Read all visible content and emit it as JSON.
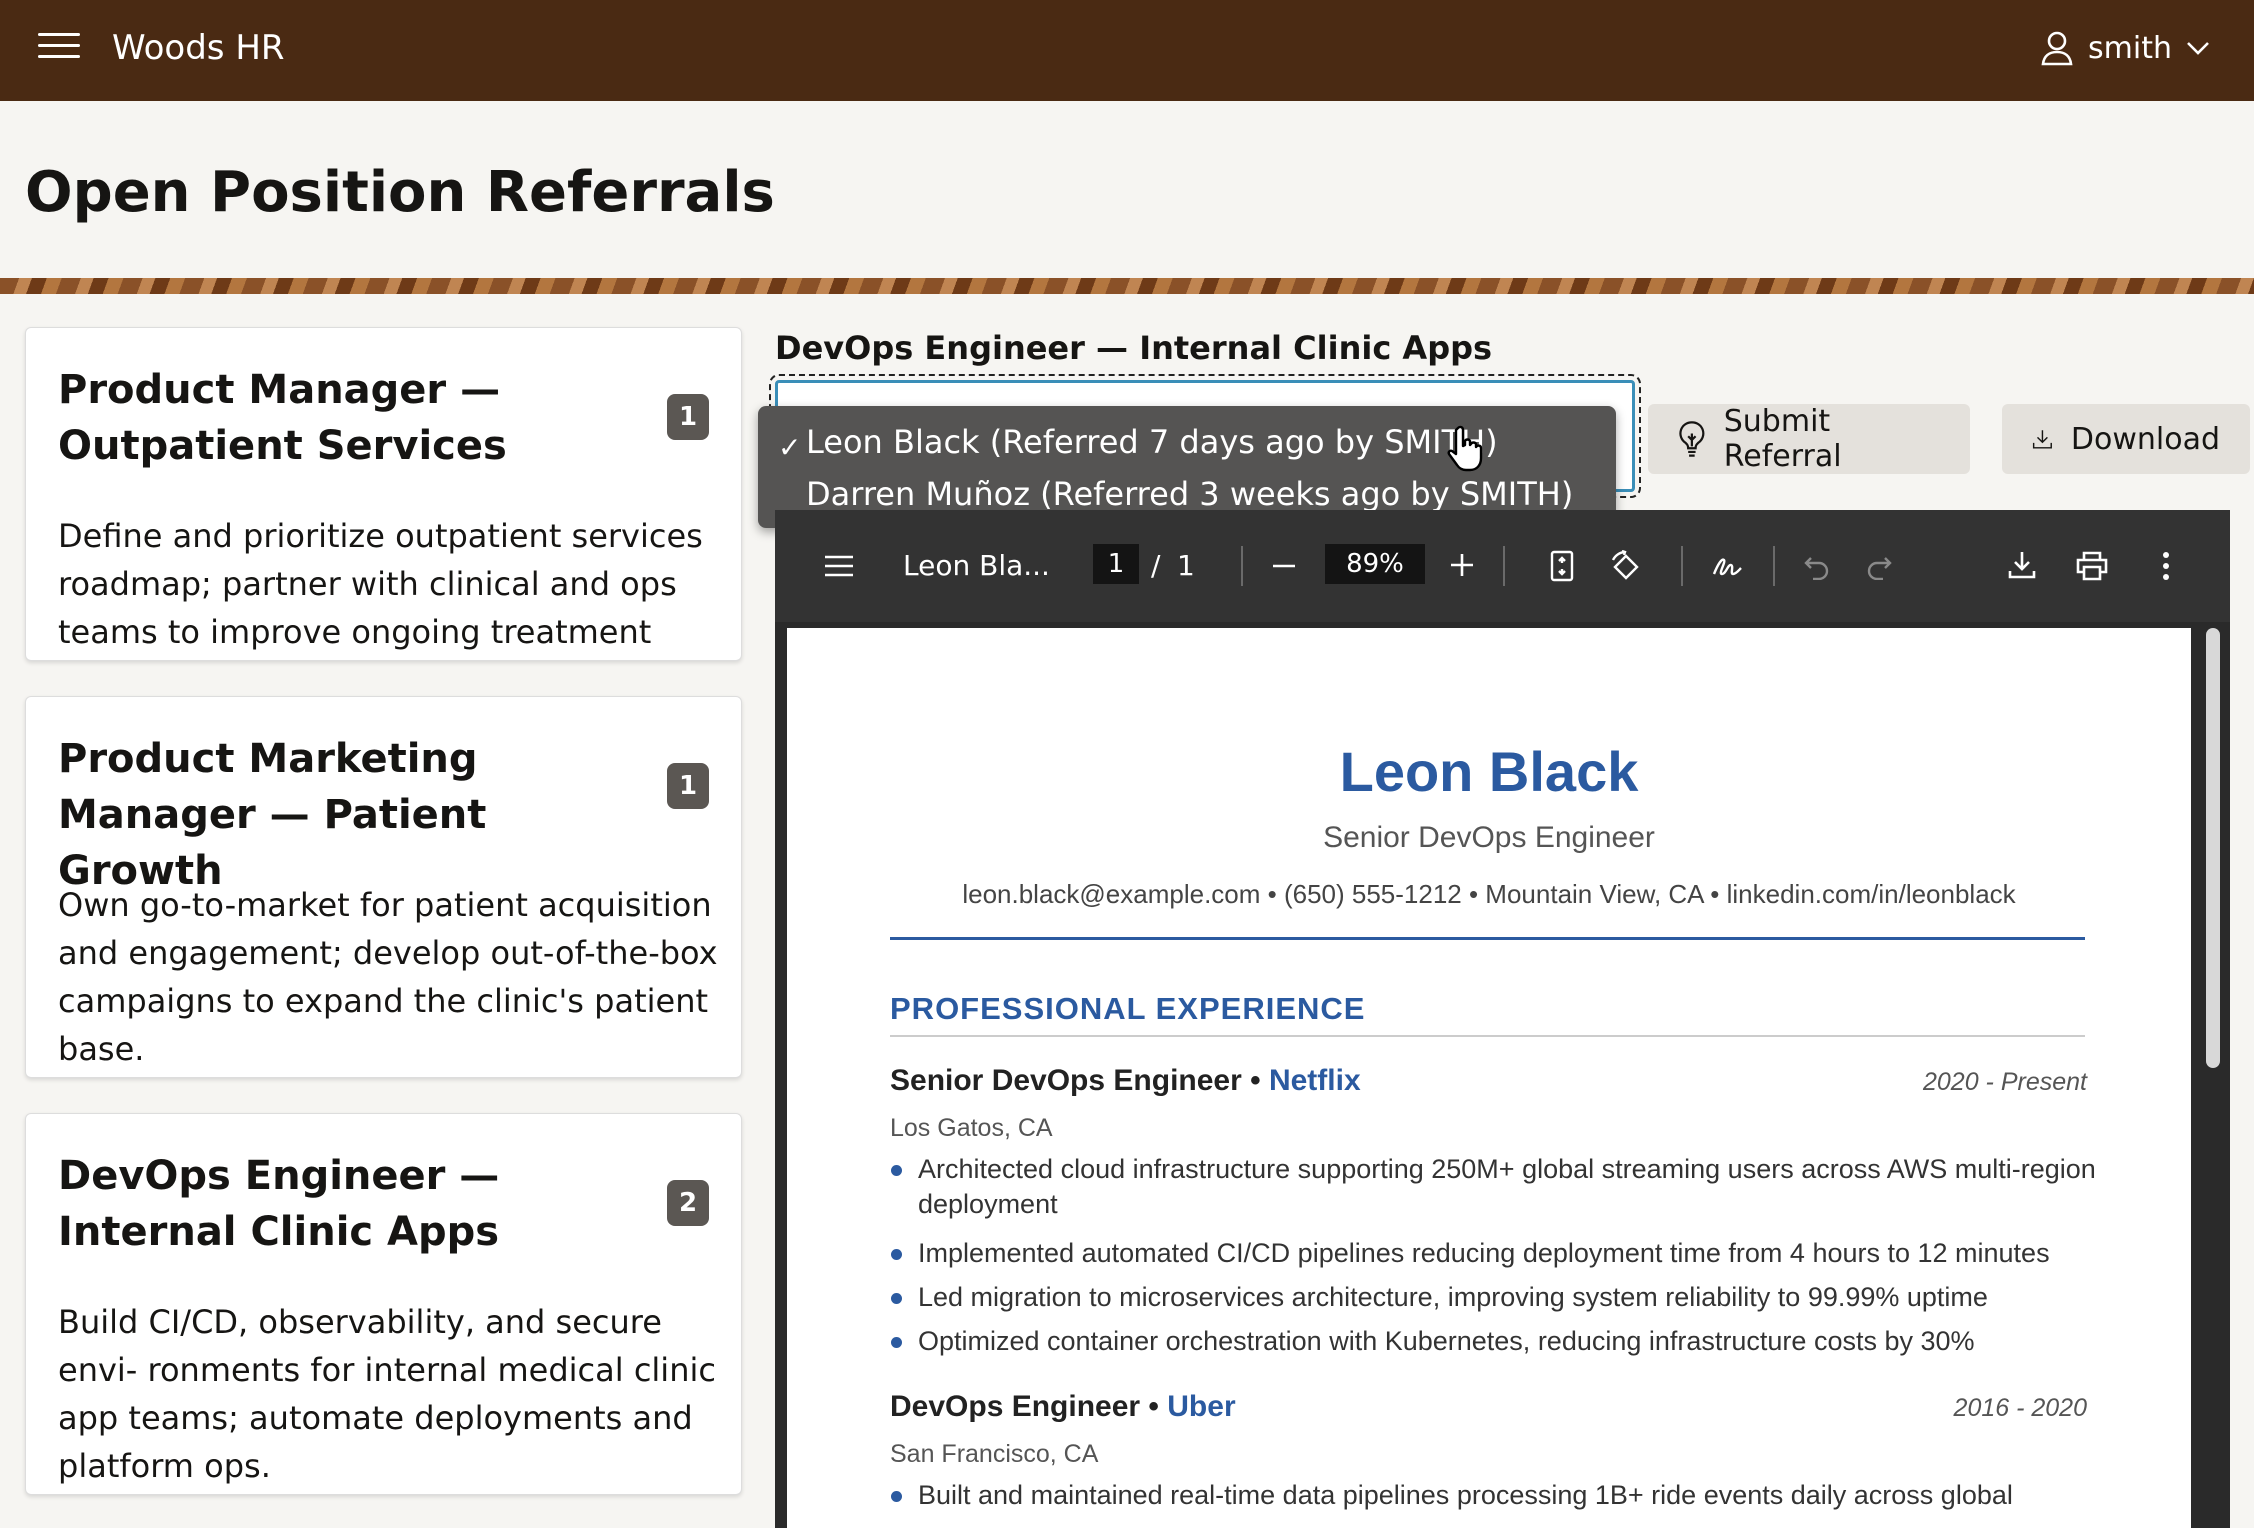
{
  "header": {
    "app_title": "Woods HR",
    "username": "smith"
  },
  "page": {
    "title": "Open Position Referrals"
  },
  "positions": [
    {
      "title": "Product Manager — Outpatient Services",
      "count": "1",
      "description": "Define and prioritize outpatient services roadmap; partner with clinical and ops teams to improve ongoing treatment experiences."
    },
    {
      "title": "Product Marketing Manager — Patient Growth",
      "count": "1",
      "description": "Own go-to-market for patient acquisition and engagement; develop out-of-the-box campaigns to expand the clinic's patient base."
    },
    {
      "title": "DevOps Engineer — Internal Clinic Apps",
      "count": "2",
      "description": "Build CI/CD, observability, and secure envi- ronments for internal medical clinic app teams; automate deployments and platform ops."
    }
  ],
  "selected_position": {
    "title": "DevOps Engineer — Internal Clinic Apps"
  },
  "referral_select": {
    "options": [
      {
        "label": "Leon Black (Referred 7 days ago by SMITH)",
        "selected": true
      },
      {
        "label": "Darren Muñoz (Referred 3 weeks ago by SMITH)",
        "selected": false
      }
    ],
    "check_mark": "✓"
  },
  "buttons": {
    "submit_referral": "Submit Referral",
    "download": "Download"
  },
  "pdf_viewer": {
    "file_name": "Leon Bla...",
    "page_current": "1",
    "page_separator": "/",
    "page_total": "1",
    "zoom": "89%"
  },
  "resume": {
    "name": "Leon Black",
    "headline": "Senior DevOps Engineer",
    "contact": "leon.black@example.com • (650) 555-1212 • Mountain View, CA • linkedin.com/in/leonblack",
    "section_experience": "PROFESSIONAL EXPERIENCE",
    "jobs": [
      {
        "title": "Senior DevOps Engineer •",
        "company": "Netflix",
        "dates": "2020 - Present",
        "location": "Los Gatos, CA",
        "bullets": [
          "Architected cloud infrastructure supporting 250M+ global streaming users across AWS multi-region deployment",
          "Implemented automated CI/CD pipelines reducing deployment time from 4 hours to 12 minutes",
          "Led migration to microservices architecture, improving system reliability to 99.99% uptime",
          "Optimized container orchestration with Kubernetes, reducing infrastructure costs by 30%"
        ]
      },
      {
        "title": "DevOps Engineer •",
        "company": "Uber",
        "dates": "2016 - 2020",
        "location": "San Francisco, CA",
        "bullets": [
          "Built and maintained real-time data pipelines processing 1B+ ride events daily across global"
        ]
      }
    ]
  },
  "colors": {
    "header_bg": "#4a2a13",
    "accent_blue": "#2b5aa0",
    "focus_ring": "#3a8eb8"
  }
}
